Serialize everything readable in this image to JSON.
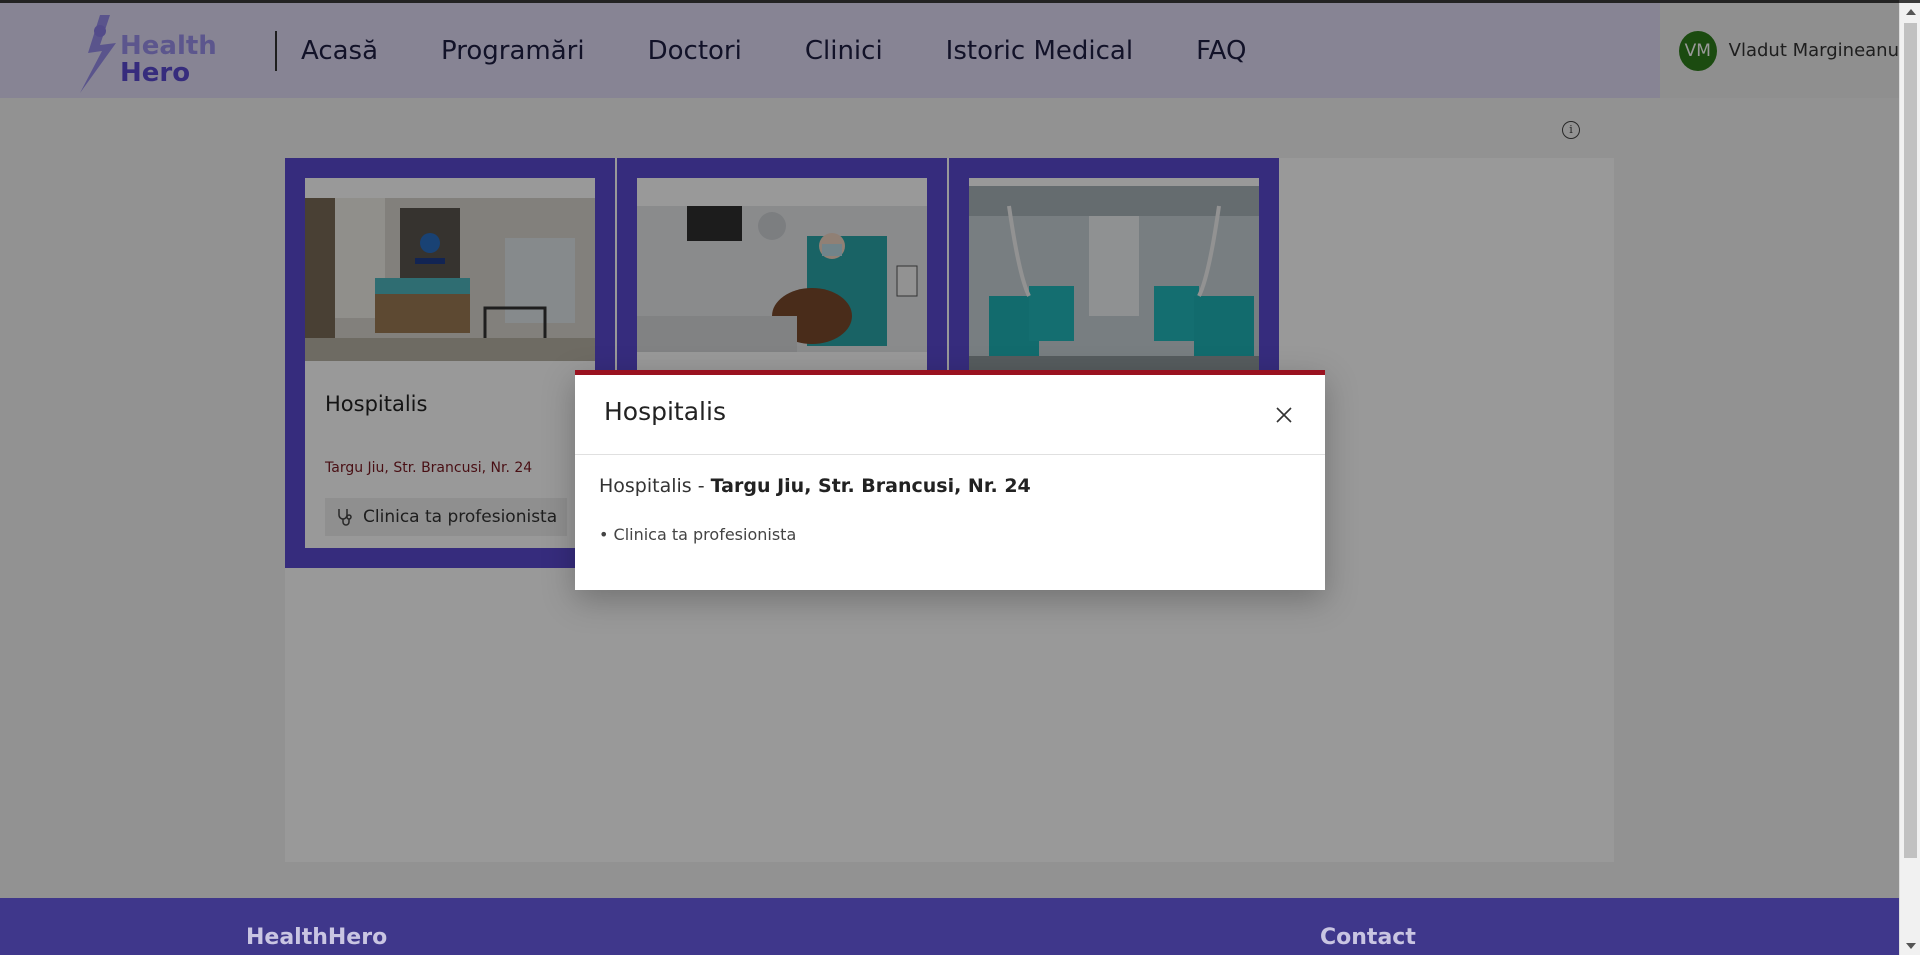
{
  "brand": {
    "logo_line1": "Health",
    "logo_line2": "Hero"
  },
  "nav": {
    "items": [
      {
        "label": "Acasă"
      },
      {
        "label": "Programări"
      },
      {
        "label": "Doctori"
      },
      {
        "label": "Clinici"
      },
      {
        "label": "Istoric Medical"
      },
      {
        "label": "FAQ"
      }
    ]
  },
  "user": {
    "initials": "VM",
    "name": "Vladut Margineanu",
    "avatar_color": "#2e7d1b"
  },
  "clinics": [
    {
      "title": "Hospitalis",
      "address": "Targu Jiu, Str. Brancusi, Nr. 24",
      "tag": "Clinica ta profesionista"
    }
  ],
  "modal": {
    "title": "Hospitalis",
    "name": "Hospitalis",
    "separator": " - ",
    "address": "Targu Jiu, Str. Brancusi, Nr. 24",
    "bullet": "• Clinica ta profesionista"
  },
  "footer": {
    "left_title": "HealthHero",
    "right_title": "Contact"
  },
  "colors": {
    "accent": "#5a4ad0",
    "modal_border": "#9a1220",
    "address": "#7a1a22"
  }
}
